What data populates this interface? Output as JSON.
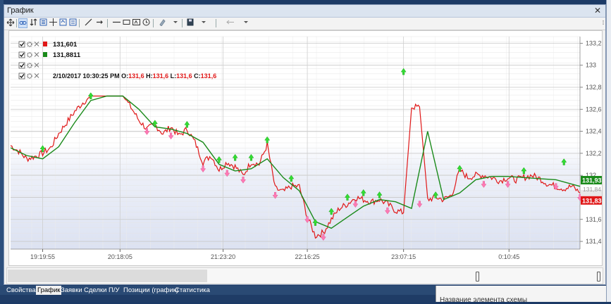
{
  "window": {
    "title": "График",
    "close_glyph": "✕"
  },
  "toolbar": {
    "icons": [
      "crosshair-move-icon",
      "link-icon",
      "sort-icon",
      "list-icon",
      "crosshair-icon",
      "zoom-icon",
      "measure-icon",
      "line-icon",
      "arrow-icon",
      "hline-icon",
      "rect-icon",
      "text-icon",
      "clock-icon",
      "draw-dropdown-icon",
      "save-dropdown-icon",
      "back-dropdown-icon"
    ]
  },
  "legend": [
    {
      "label": "131,601",
      "color": "#e01818"
    },
    {
      "label": "131,8811",
      "color": "#1a8a1a"
    },
    {
      "label": ""
    },
    {
      "label": "2/10/2017 10:30:25 PM",
      "ohlc": [
        {
          "key": "O:",
          "value": "131,6"
        },
        {
          "key": "H:",
          "value": "131,6"
        },
        {
          "key": "L:",
          "value": "131,6"
        },
        {
          "key": "C:",
          "value": "131,6"
        }
      ]
    }
  ],
  "price_badges": {
    "green": "131,937",
    "red": "131,836",
    "hidden": "131,84"
  },
  "colors": {
    "price_line": "#e01818",
    "ma_line": "#1a8a1a",
    "buy_arrow": "#33dd33",
    "sell_arrow": "#ff7ab4"
  },
  "chart_data": {
    "type": "line",
    "x_ticks": [
      "19:19:55",
      "20:18:05",
      "21:23:20",
      "22:16:25",
      "23:07:15",
      "0:10:45"
    ],
    "y_ticks": [
      "133,2",
      "133",
      "132,8",
      "132,6",
      "132,4",
      "132,2",
      "132",
      "131,8",
      "131,6",
      "131,4"
    ],
    "ylim": [
      131.33,
      133.26
    ],
    "grid": true,
    "series": [
      {
        "name": "131,601",
        "points": [
          [
            0,
            132.27
          ],
          [
            0.02,
            132.22
          ],
          [
            0.04,
            132.15
          ],
          [
            0.06,
            132.17
          ],
          [
            0.08,
            132.2
          ],
          [
            0.1,
            132.25
          ],
          [
            0.12,
            132.38
          ],
          [
            0.14,
            132.48
          ],
          [
            0.16,
            132.58
          ],
          [
            0.18,
            132.66
          ],
          [
            0.2,
            132.72
          ],
          [
            0.22,
            132.72
          ],
          [
            0.25,
            132.72
          ],
          [
            0.28,
            132.72
          ],
          [
            0.3,
            132.62
          ],
          [
            0.32,
            132.5
          ],
          [
            0.34,
            132.42
          ],
          [
            0.36,
            132.46
          ],
          [
            0.38,
            132.38
          ],
          [
            0.4,
            132.44
          ],
          [
            0.42,
            132.36
          ],
          [
            0.44,
            132.42
          ],
          [
            0.46,
            132.3
          ],
          [
            0.48,
            132.12
          ],
          [
            0.5,
            132.18
          ],
          [
            0.52,
            132.05
          ],
          [
            0.54,
            132.12
          ],
          [
            0.56,
            132.08
          ],
          [
            0.58,
            132.0
          ],
          [
            0.6,
            132.12
          ],
          [
            0.62,
            132.1
          ],
          [
            0.64,
            132.28
          ],
          [
            0.66,
            131.88
          ],
          [
            0.68,
            131.85
          ],
          [
            0.7,
            131.9
          ],
          [
            0.72,
            131.9
          ],
          [
            0.74,
            131.62
          ],
          [
            0.76,
            131.45
          ],
          [
            0.78,
            131.48
          ],
          [
            0.8,
            131.6
          ],
          [
            0.82,
            131.7
          ],
          [
            0.84,
            131.74
          ],
          [
            0.86,
            131.8
          ],
          [
            0.88,
            131.78
          ],
          [
            0.9,
            131.76
          ],
          [
            0.92,
            131.78
          ],
          [
            0.94,
            131.74
          ],
          [
            0.96,
            131.68
          ],
          [
            0.98,
            131.66
          ],
          [
            1.0,
            132.62
          ],
          [
            1.02,
            132.62
          ],
          [
            1.04,
            131.78
          ],
          [
            1.06,
            131.8
          ],
          [
            1.08,
            131.78
          ],
          [
            1.1,
            131.82
          ],
          [
            1.12,
            132.05
          ],
          [
            1.14,
            131.98
          ],
          [
            1.16,
            132.0
          ],
          [
            1.18,
            132.0
          ],
          [
            1.2,
            131.98
          ],
          [
            1.22,
            131.95
          ],
          [
            1.24,
            131.98
          ],
          [
            1.26,
            131.96
          ],
          [
            1.28,
            131.98
          ],
          [
            1.3,
            132.0
          ],
          [
            1.32,
            131.97
          ],
          [
            1.34,
            131.92
          ],
          [
            1.36,
            131.9
          ],
          [
            1.38,
            131.88
          ],
          [
            1.4,
            131.9
          ],
          [
            1.42,
            131.84
          ]
        ]
      },
      {
        "name": "131,8811",
        "points": [
          [
            0,
            132.25
          ],
          [
            0.04,
            132.18
          ],
          [
            0.08,
            132.15
          ],
          [
            0.12,
            132.26
          ],
          [
            0.16,
            132.48
          ],
          [
            0.2,
            132.68
          ],
          [
            0.24,
            132.72
          ],
          [
            0.28,
            132.72
          ],
          [
            0.32,
            132.6
          ],
          [
            0.36,
            132.44
          ],
          [
            0.4,
            132.42
          ],
          [
            0.44,
            132.38
          ],
          [
            0.48,
            132.3
          ],
          [
            0.52,
            132.1
          ],
          [
            0.56,
            132.04
          ],
          [
            0.6,
            132.06
          ],
          [
            0.64,
            132.15
          ],
          [
            0.68,
            131.98
          ],
          [
            0.72,
            131.86
          ],
          [
            0.76,
            131.58
          ],
          [
            0.8,
            131.52
          ],
          [
            0.84,
            131.62
          ],
          [
            0.88,
            131.72
          ],
          [
            0.92,
            131.78
          ],
          [
            0.96,
            131.76
          ],
          [
            1.0,
            131.7
          ],
          [
            1.04,
            132.4
          ],
          [
            1.08,
            131.78
          ],
          [
            1.12,
            131.84
          ],
          [
            1.16,
            131.96
          ],
          [
            1.2,
            131.99
          ],
          [
            1.24,
            131.99
          ],
          [
            1.28,
            131.98
          ],
          [
            1.32,
            131.97
          ],
          [
            1.36,
            131.96
          ],
          [
            1.4,
            131.92
          ],
          [
            1.42,
            131.9
          ]
        ]
      }
    ],
    "buy_signals": [
      [
        0.08,
        132.22
      ],
      [
        0.2,
        132.7
      ],
      [
        0.36,
        132.45
      ],
      [
        0.44,
        132.44
      ],
      [
        0.52,
        132.12
      ],
      [
        0.56,
        132.14
      ],
      [
        0.6,
        132.14
      ],
      [
        0.64,
        132.3
      ],
      [
        0.7,
        131.95
      ],
      [
        0.76,
        131.55
      ],
      [
        0.8,
        131.65
      ],
      [
        0.84,
        131.78
      ],
      [
        0.88,
        131.82
      ],
      [
        0.92,
        131.8
      ],
      [
        0.98,
        132.92
      ],
      [
        1.06,
        131.8
      ],
      [
        1.12,
        132.04
      ],
      [
        1.28,
        132.02
      ],
      [
        1.38,
        132.1
      ]
    ],
    "sell_signals": [
      [
        0.34,
        132.42
      ],
      [
        0.4,
        132.38
      ],
      [
        0.48,
        132.08
      ],
      [
        0.54,
        132.04
      ],
      [
        0.58,
        131.98
      ],
      [
        0.66,
        131.84
      ],
      [
        0.74,
        131.62
      ],
      [
        0.78,
        131.46
      ],
      [
        0.86,
        131.76
      ],
      [
        0.94,
        131.7
      ],
      [
        1.02,
        131.76
      ],
      [
        1.18,
        131.94
      ],
      [
        1.24,
        131.94
      ],
      [
        1.36,
        131.92
      ],
      [
        1.42,
        131.82
      ]
    ]
  },
  "scrollbar": {
    "position": 0.335
  },
  "tabs": [
    {
      "label": "Свойства"
    },
    {
      "label": "График",
      "active": true
    },
    {
      "label": "Заявки"
    },
    {
      "label": "Сделки"
    },
    {
      "label": "П/У"
    },
    {
      "label": "Позиции (график)"
    },
    {
      "label": "Статистика"
    }
  ],
  "right_panel": {
    "label": "Название элемента схемы"
  }
}
